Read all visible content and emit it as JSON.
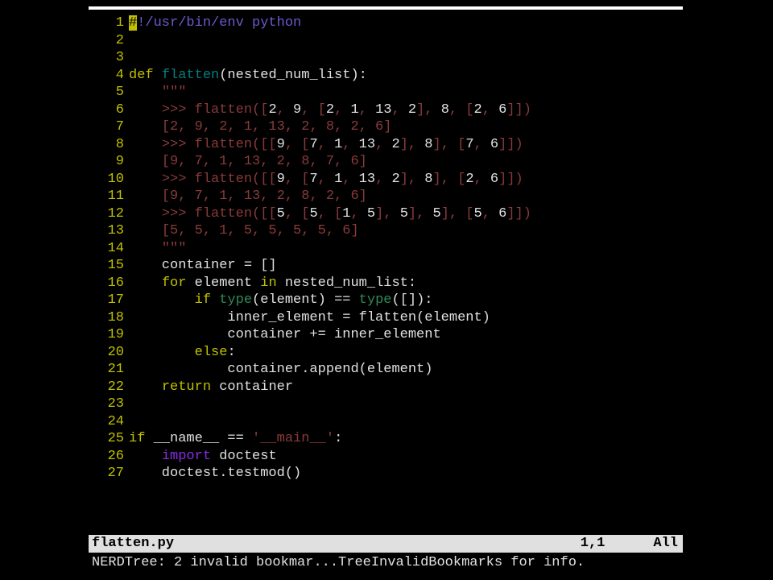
{
  "status": {
    "filename": "flatten.py",
    "position": "1,1",
    "percent": "All"
  },
  "commandline": "NERDTree: 2 invalid bookmar...TreeInvalidBookmarks for info.",
  "lines": [
    {
      "n": "1",
      "seg": [
        {
          "t": "#",
          "cls": "cursor"
        },
        {
          "t": "!/usr/bin/env python",
          "cls": "comment"
        }
      ]
    },
    {
      "n": "2",
      "seg": []
    },
    {
      "n": "3",
      "seg": []
    },
    {
      "n": "4",
      "seg": [
        {
          "t": "def",
          "cls": "statement"
        },
        {
          "t": " ",
          "cls": "normal"
        },
        {
          "t": "flatten",
          "cls": "identifier"
        },
        {
          "t": "(nested_num_list):",
          "cls": "normal"
        }
      ]
    },
    {
      "n": "5",
      "seg": [
        {
          "t": "    ",
          "cls": "normal"
        },
        {
          "t": "\"\"\"",
          "cls": "string"
        }
      ]
    },
    {
      "n": "6",
      "seg": [
        {
          "t": "    ",
          "cls": "normal"
        },
        {
          "t": ">>> flatten([",
          "cls": "string"
        },
        {
          "t": "2",
          "cls": "normal"
        },
        {
          "t": ", ",
          "cls": "string"
        },
        {
          "t": "9",
          "cls": "normal"
        },
        {
          "t": ", [",
          "cls": "string"
        },
        {
          "t": "2",
          "cls": "normal"
        },
        {
          "t": ", ",
          "cls": "string"
        },
        {
          "t": "1",
          "cls": "normal"
        },
        {
          "t": ", ",
          "cls": "string"
        },
        {
          "t": "13",
          "cls": "normal"
        },
        {
          "t": ", ",
          "cls": "string"
        },
        {
          "t": "2",
          "cls": "normal"
        },
        {
          "t": "], ",
          "cls": "string"
        },
        {
          "t": "8",
          "cls": "normal"
        },
        {
          "t": ", [",
          "cls": "string"
        },
        {
          "t": "2",
          "cls": "normal"
        },
        {
          "t": ", ",
          "cls": "string"
        },
        {
          "t": "6",
          "cls": "normal"
        },
        {
          "t": "]])",
          "cls": "string"
        }
      ]
    },
    {
      "n": "7",
      "seg": [
        {
          "t": "    ",
          "cls": "normal"
        },
        {
          "t": "[2, 9, 2, 1, 13, 2, 8, 2, 6]",
          "cls": "string"
        }
      ]
    },
    {
      "n": "8",
      "seg": [
        {
          "t": "    ",
          "cls": "normal"
        },
        {
          "t": ">>> flatten([[",
          "cls": "string"
        },
        {
          "t": "9",
          "cls": "normal"
        },
        {
          "t": ", [",
          "cls": "string"
        },
        {
          "t": "7",
          "cls": "normal"
        },
        {
          "t": ", ",
          "cls": "string"
        },
        {
          "t": "1",
          "cls": "normal"
        },
        {
          "t": ", ",
          "cls": "string"
        },
        {
          "t": "13",
          "cls": "normal"
        },
        {
          "t": ", ",
          "cls": "string"
        },
        {
          "t": "2",
          "cls": "normal"
        },
        {
          "t": "], ",
          "cls": "string"
        },
        {
          "t": "8",
          "cls": "normal"
        },
        {
          "t": "], [",
          "cls": "string"
        },
        {
          "t": "7",
          "cls": "normal"
        },
        {
          "t": ", ",
          "cls": "string"
        },
        {
          "t": "6",
          "cls": "normal"
        },
        {
          "t": "]])",
          "cls": "string"
        }
      ]
    },
    {
      "n": "9",
      "seg": [
        {
          "t": "    ",
          "cls": "normal"
        },
        {
          "t": "[9, 7, 1, 13, 2, 8, 7, 6]",
          "cls": "string"
        }
      ]
    },
    {
      "n": "10",
      "seg": [
        {
          "t": "    ",
          "cls": "normal"
        },
        {
          "t": ">>> flatten([[",
          "cls": "string"
        },
        {
          "t": "9",
          "cls": "normal"
        },
        {
          "t": ", [",
          "cls": "string"
        },
        {
          "t": "7",
          "cls": "normal"
        },
        {
          "t": ", ",
          "cls": "string"
        },
        {
          "t": "1",
          "cls": "normal"
        },
        {
          "t": ", ",
          "cls": "string"
        },
        {
          "t": "13",
          "cls": "normal"
        },
        {
          "t": ", ",
          "cls": "string"
        },
        {
          "t": "2",
          "cls": "normal"
        },
        {
          "t": "], ",
          "cls": "string"
        },
        {
          "t": "8",
          "cls": "normal"
        },
        {
          "t": "], [",
          "cls": "string"
        },
        {
          "t": "2",
          "cls": "normal"
        },
        {
          "t": ", ",
          "cls": "string"
        },
        {
          "t": "6",
          "cls": "normal"
        },
        {
          "t": "]])",
          "cls": "string"
        }
      ]
    },
    {
      "n": "11",
      "seg": [
        {
          "t": "    ",
          "cls": "normal"
        },
        {
          "t": "[9, 7, 1, 13, 2, 8, 2, 6]",
          "cls": "string"
        }
      ]
    },
    {
      "n": "12",
      "seg": [
        {
          "t": "    ",
          "cls": "normal"
        },
        {
          "t": ">>> flatten([[",
          "cls": "string"
        },
        {
          "t": "5",
          "cls": "normal"
        },
        {
          "t": ", [",
          "cls": "string"
        },
        {
          "t": "5",
          "cls": "normal"
        },
        {
          "t": ", [",
          "cls": "string"
        },
        {
          "t": "1",
          "cls": "normal"
        },
        {
          "t": ", ",
          "cls": "string"
        },
        {
          "t": "5",
          "cls": "normal"
        },
        {
          "t": "], ",
          "cls": "string"
        },
        {
          "t": "5",
          "cls": "normal"
        },
        {
          "t": "], ",
          "cls": "string"
        },
        {
          "t": "5",
          "cls": "normal"
        },
        {
          "t": "], [",
          "cls": "string"
        },
        {
          "t": "5",
          "cls": "normal"
        },
        {
          "t": ", ",
          "cls": "string"
        },
        {
          "t": "6",
          "cls": "normal"
        },
        {
          "t": "]])",
          "cls": "string"
        }
      ]
    },
    {
      "n": "13",
      "seg": [
        {
          "t": "    ",
          "cls": "normal"
        },
        {
          "t": "[5, 5, 1, 5, 5, 5, 5, 6]",
          "cls": "string"
        }
      ]
    },
    {
      "n": "14",
      "seg": [
        {
          "t": "    ",
          "cls": "normal"
        },
        {
          "t": "\"\"\"",
          "cls": "string"
        }
      ]
    },
    {
      "n": "15",
      "seg": [
        {
          "t": "    container = []",
          "cls": "normal"
        }
      ]
    },
    {
      "n": "16",
      "seg": [
        {
          "t": "    ",
          "cls": "normal"
        },
        {
          "t": "for",
          "cls": "statement"
        },
        {
          "t": " element ",
          "cls": "normal"
        },
        {
          "t": "in",
          "cls": "statement"
        },
        {
          "t": " nested_num_list:",
          "cls": "normal"
        }
      ]
    },
    {
      "n": "17",
      "seg": [
        {
          "t": "        ",
          "cls": "normal"
        },
        {
          "t": "if",
          "cls": "statement"
        },
        {
          "t": " ",
          "cls": "normal"
        },
        {
          "t": "type",
          "cls": "type"
        },
        {
          "t": "(element) == ",
          "cls": "normal"
        },
        {
          "t": "type",
          "cls": "type"
        },
        {
          "t": "([]):",
          "cls": "normal"
        }
      ]
    },
    {
      "n": "18",
      "seg": [
        {
          "t": "            inner_element = flatten(element)",
          "cls": "normal"
        }
      ]
    },
    {
      "n": "19",
      "seg": [
        {
          "t": "            container += inner_element",
          "cls": "normal"
        }
      ]
    },
    {
      "n": "20",
      "seg": [
        {
          "t": "        ",
          "cls": "normal"
        },
        {
          "t": "else",
          "cls": "statement"
        },
        {
          "t": ":",
          "cls": "normal"
        }
      ]
    },
    {
      "n": "21",
      "seg": [
        {
          "t": "            container.append(element)",
          "cls": "normal"
        }
      ]
    },
    {
      "n": "22",
      "seg": [
        {
          "t": "    ",
          "cls": "normal"
        },
        {
          "t": "return",
          "cls": "statement"
        },
        {
          "t": " container",
          "cls": "normal"
        }
      ]
    },
    {
      "n": "23",
      "seg": []
    },
    {
      "n": "24",
      "seg": []
    },
    {
      "n": "25",
      "seg": [
        {
          "t": "if",
          "cls": "statement"
        },
        {
          "t": " __name__ == ",
          "cls": "normal"
        },
        {
          "t": "'__main__'",
          "cls": "string"
        },
        {
          "t": ":",
          "cls": "normal"
        }
      ]
    },
    {
      "n": "26",
      "seg": [
        {
          "t": "    ",
          "cls": "normal"
        },
        {
          "t": "import",
          "cls": "preproc"
        },
        {
          "t": " doctest",
          "cls": "normal"
        }
      ]
    },
    {
      "n": "27",
      "seg": [
        {
          "t": "    doctest.testmod()",
          "cls": "normal"
        }
      ]
    }
  ]
}
